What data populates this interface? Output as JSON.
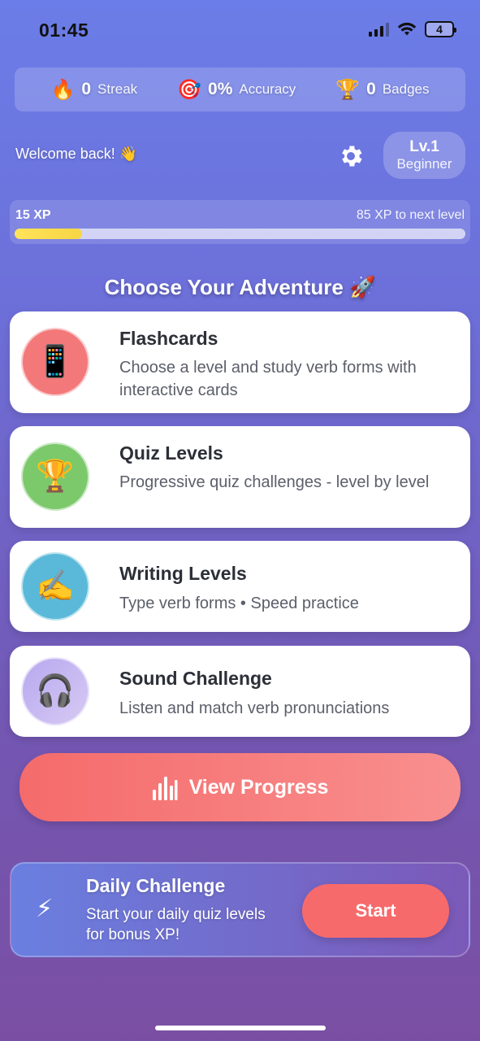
{
  "status_bar": {
    "time": "01:45",
    "battery": "4"
  },
  "stats": [
    {
      "icon": "fire-icon",
      "emoji": "🔥",
      "value": "0",
      "label": "Streak"
    },
    {
      "icon": "target-icon",
      "emoji": "🎯",
      "value": "0%",
      "label": "Accuracy"
    },
    {
      "icon": "trophy-icon",
      "emoji": "🏆",
      "value": "0",
      "label": "Badges"
    }
  ],
  "header": {
    "welcome": "Welcome back! 👋",
    "level": "Lv.1",
    "rank": "Beginner"
  },
  "xp": {
    "current": "15 XP",
    "next": "85 XP to next level",
    "progress": 0.15,
    "fill_color": "#f7d544"
  },
  "section_title": "Choose Your Adventure 🚀",
  "modes": [
    {
      "icon": "flashcard-icon",
      "emoji": "📱",
      "title": "Flashcards",
      "description": "Choose a level and study verb forms with interactive cards",
      "color": "#f3787a"
    },
    {
      "icon": "trophy-icon",
      "emoji": "🏆",
      "title": "Quiz Levels",
      "description": "Progressive quiz challenges - level by level",
      "color": "#7cc96c"
    },
    {
      "icon": "writing-hand-icon",
      "emoji": "✍️",
      "title": "Writing Levels",
      "description": "Type verb forms • Speed practice",
      "color": "#5ab9d8"
    },
    {
      "icon": "headphones-icon",
      "emoji": "🎧",
      "title": "Sound Challenge",
      "description": "Listen and match verb pronunciations",
      "color": "#c6b8f1"
    }
  ],
  "progress_button": {
    "label": "View Progress",
    "icon": "bar-chart-icon"
  },
  "daily": {
    "icon": "lightning-icon",
    "emoji": "⚡",
    "title": "Daily Challenge",
    "description": "Start your daily quiz levels for bonus XP!",
    "button": "Start"
  },
  "colors": {
    "accent": "#f76a6b",
    "card_bg": "#ffffff"
  }
}
